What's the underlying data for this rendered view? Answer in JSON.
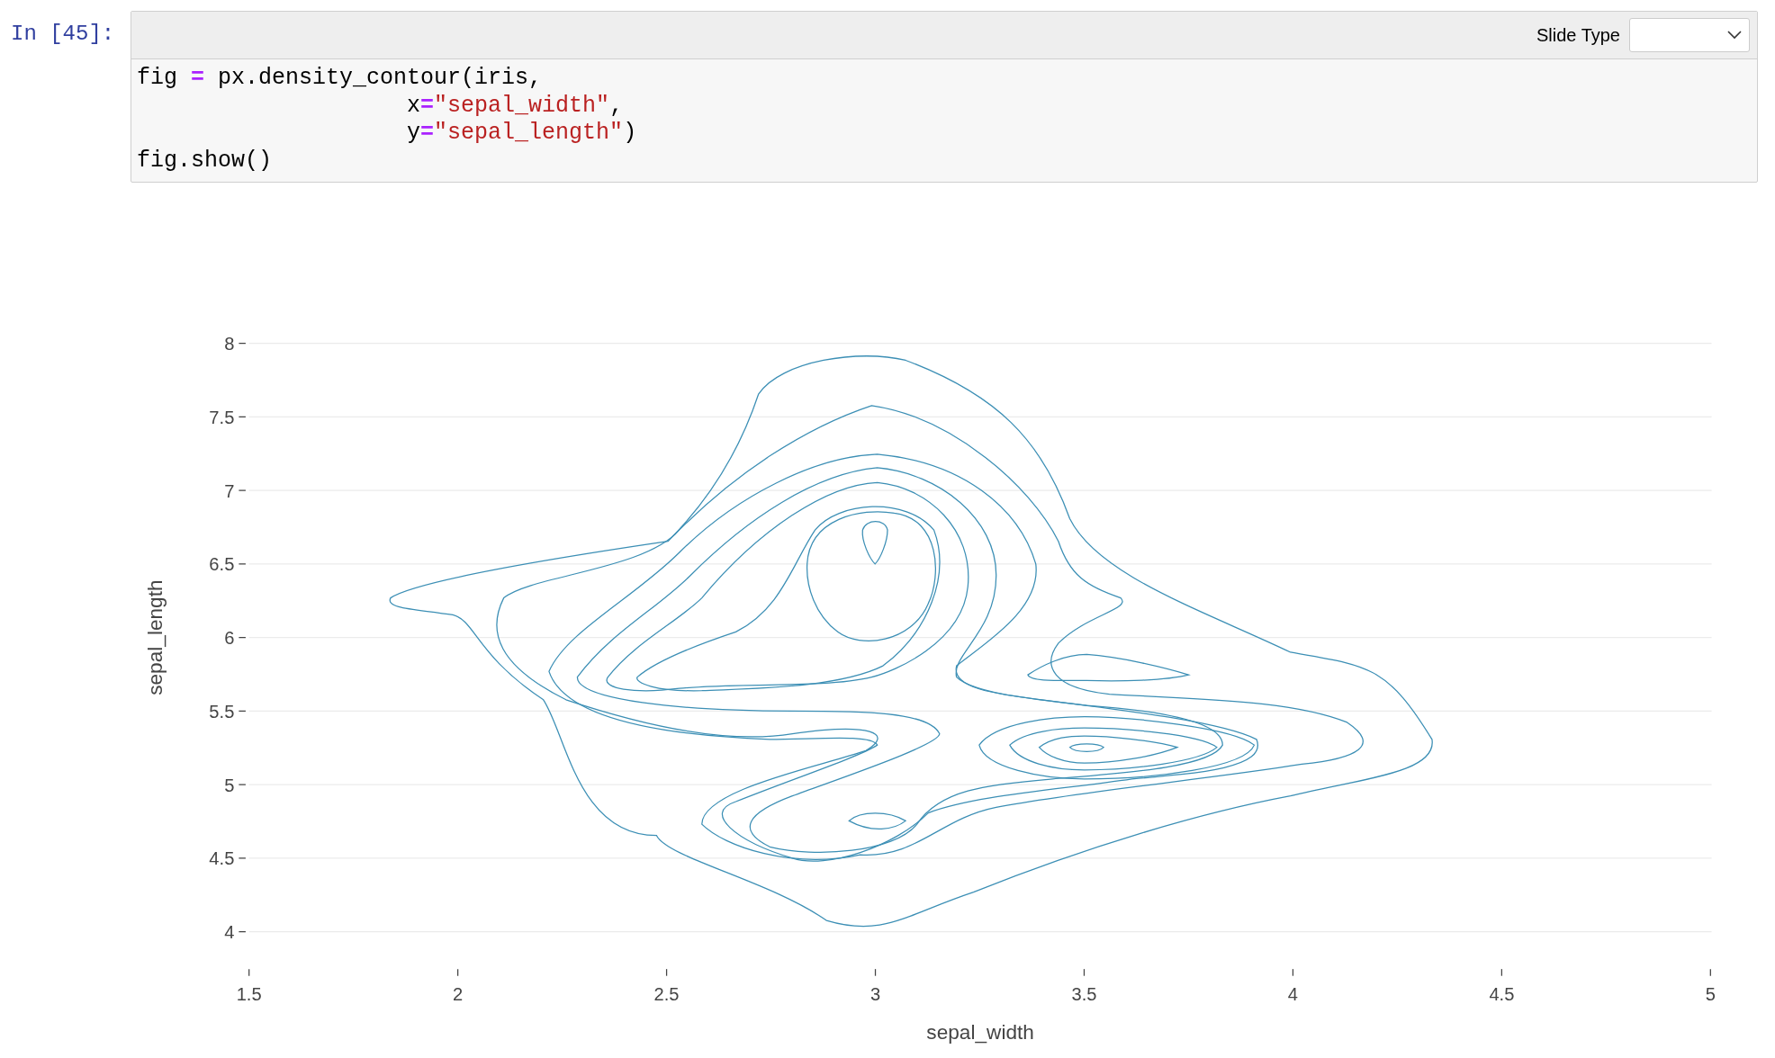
{
  "cell": {
    "prompt": "In [45]:",
    "toolbar": {
      "label": "Slide Type"
    },
    "code_lines": [
      [
        {
          "kind": "plain",
          "text": "fig "
        },
        {
          "kind": "operator",
          "text": "="
        },
        {
          "kind": "plain",
          "text": " px.density_contour(iris,"
        }
      ],
      [
        {
          "kind": "plain",
          "text": "                    x"
        },
        {
          "kind": "operator",
          "text": "="
        },
        {
          "kind": "string",
          "text": "\"sepal_width\""
        },
        {
          "kind": "plain",
          "text": ","
        }
      ],
      [
        {
          "kind": "plain",
          "text": "                    y"
        },
        {
          "kind": "operator",
          "text": "="
        },
        {
          "kind": "string",
          "text": "\"sepal_length\""
        },
        {
          "kind": "plain",
          "text": ")"
        }
      ],
      [
        {
          "kind": "plain",
          "text": "fig.show()"
        }
      ]
    ]
  },
  "plot": {
    "xlabel": "sepal_width",
    "ylabel": "sepal_length",
    "xticks": [
      "1.5",
      "2",
      "2.5",
      "3",
      "3.5",
      "4",
      "4.5",
      "5"
    ],
    "yticks": [
      "8",
      "7.5",
      "7",
      "6.5",
      "6",
      "5.5",
      "5",
      "4.5",
      "4"
    ]
  }
}
